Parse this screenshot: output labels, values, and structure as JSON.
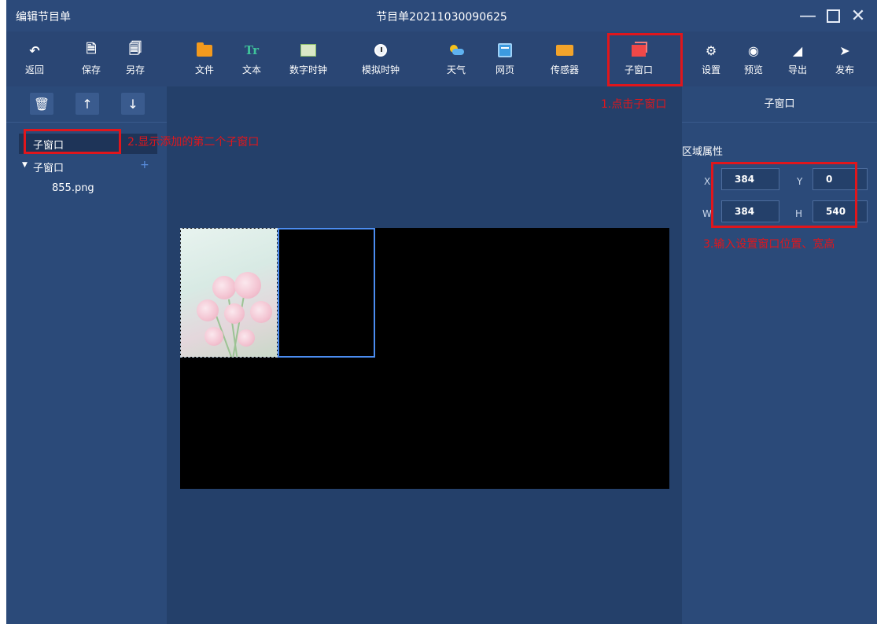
{
  "window": {
    "left_title": "编辑节目单",
    "center_title": "节目单20211030090625"
  },
  "toolbar": {
    "back": "返回",
    "save": "保存",
    "save_as": "另存",
    "file": "文件",
    "text": "文本",
    "text_icon": "Tr",
    "digital_clock": "数字时钟",
    "analog_clock": "模拟时钟",
    "weather": "天气",
    "webpage": "网页",
    "sensor": "传感器",
    "subwindow": "子窗口",
    "settings": "设置",
    "preview": "预览",
    "export": "导出",
    "publish": "发布"
  },
  "tree": {
    "items": [
      {
        "label": "子窗口",
        "selected": true
      },
      {
        "label": "子窗口",
        "expanded": true
      },
      {
        "label": "855.png"
      }
    ]
  },
  "right_panel": {
    "title": "子窗口",
    "section": "区域属性",
    "x_label": "X",
    "x_value": "384",
    "y_label": "Y",
    "y_value": "0",
    "w_label": "W",
    "w_value": "384",
    "h_label": "H",
    "h_value": "540"
  },
  "annotations": {
    "step1": "1.点击子窗口",
    "step2": "2.显示添加的第二个子窗口",
    "step3": "3.输入设置窗口位置、宽高"
  },
  "colors": {
    "annotation_red": "#e0161c",
    "panel_bg": "#2b4a79",
    "canvas_bg": "#24406a",
    "selection_blue": "#4b8cf0"
  },
  "icons": [
    "undo-icon",
    "save-icon",
    "save-as-icon",
    "folder-icon",
    "text-icon",
    "digital-clock-icon",
    "analog-clock-icon",
    "weather-icon",
    "webpage-icon",
    "sensor-icon",
    "subwindow-icon",
    "settings-icon",
    "preview-icon",
    "export-icon",
    "publish-icon",
    "trash-icon",
    "arrow-up-icon",
    "arrow-down-icon",
    "plus-icon",
    "caret-down-icon"
  ]
}
